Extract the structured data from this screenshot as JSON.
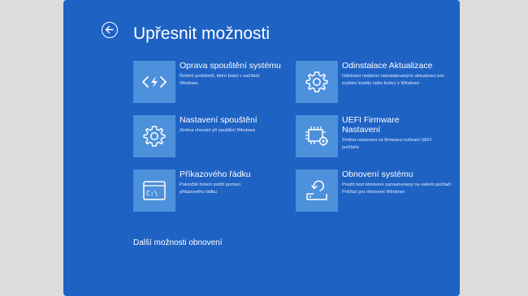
{
  "header": {
    "title": "Upřesnit možnosti"
  },
  "tiles": [
    {
      "title": "Oprava spouštění systému",
      "desc": "Řešení problémů, které brání v načítání Windows",
      "icon": "startup-repair-icon"
    },
    {
      "title": "Odinstalace Aktualizace",
      "desc": "Odebrání nedávno nainstalovaných aktualizací pro zvýšení kvality nebo funkcí z Windows",
      "icon": "gear-icon"
    },
    {
      "title": "Nastavení spouštění",
      "desc": "Změna chování při spuštění Windows",
      "icon": "gear-icon"
    },
    {
      "title": "UEFI  Firmware Nastavení",
      "desc": "Změna nastavení ve firmwaru rozhraní UEFI počítače",
      "icon": "chip-gear-icon"
    },
    {
      "title": "Příkazového řádku",
      "desc": "Pokročilé řešení potíží pomocí příkazového řádku",
      "icon": "command-prompt-icon"
    },
    {
      "title": "Obnovení systému",
      "desc": "Použít bod obnovení zaznamenaný na vašem počítači Počítač pro obnovení Windows",
      "icon": "system-restore-icon"
    }
  ],
  "footer": {
    "more_options": "Další možnosti obnovení"
  },
  "colors": {
    "background": "#1e62c4",
    "tile_icon_bg": "#4d90dc",
    "text": "#ffffff"
  }
}
